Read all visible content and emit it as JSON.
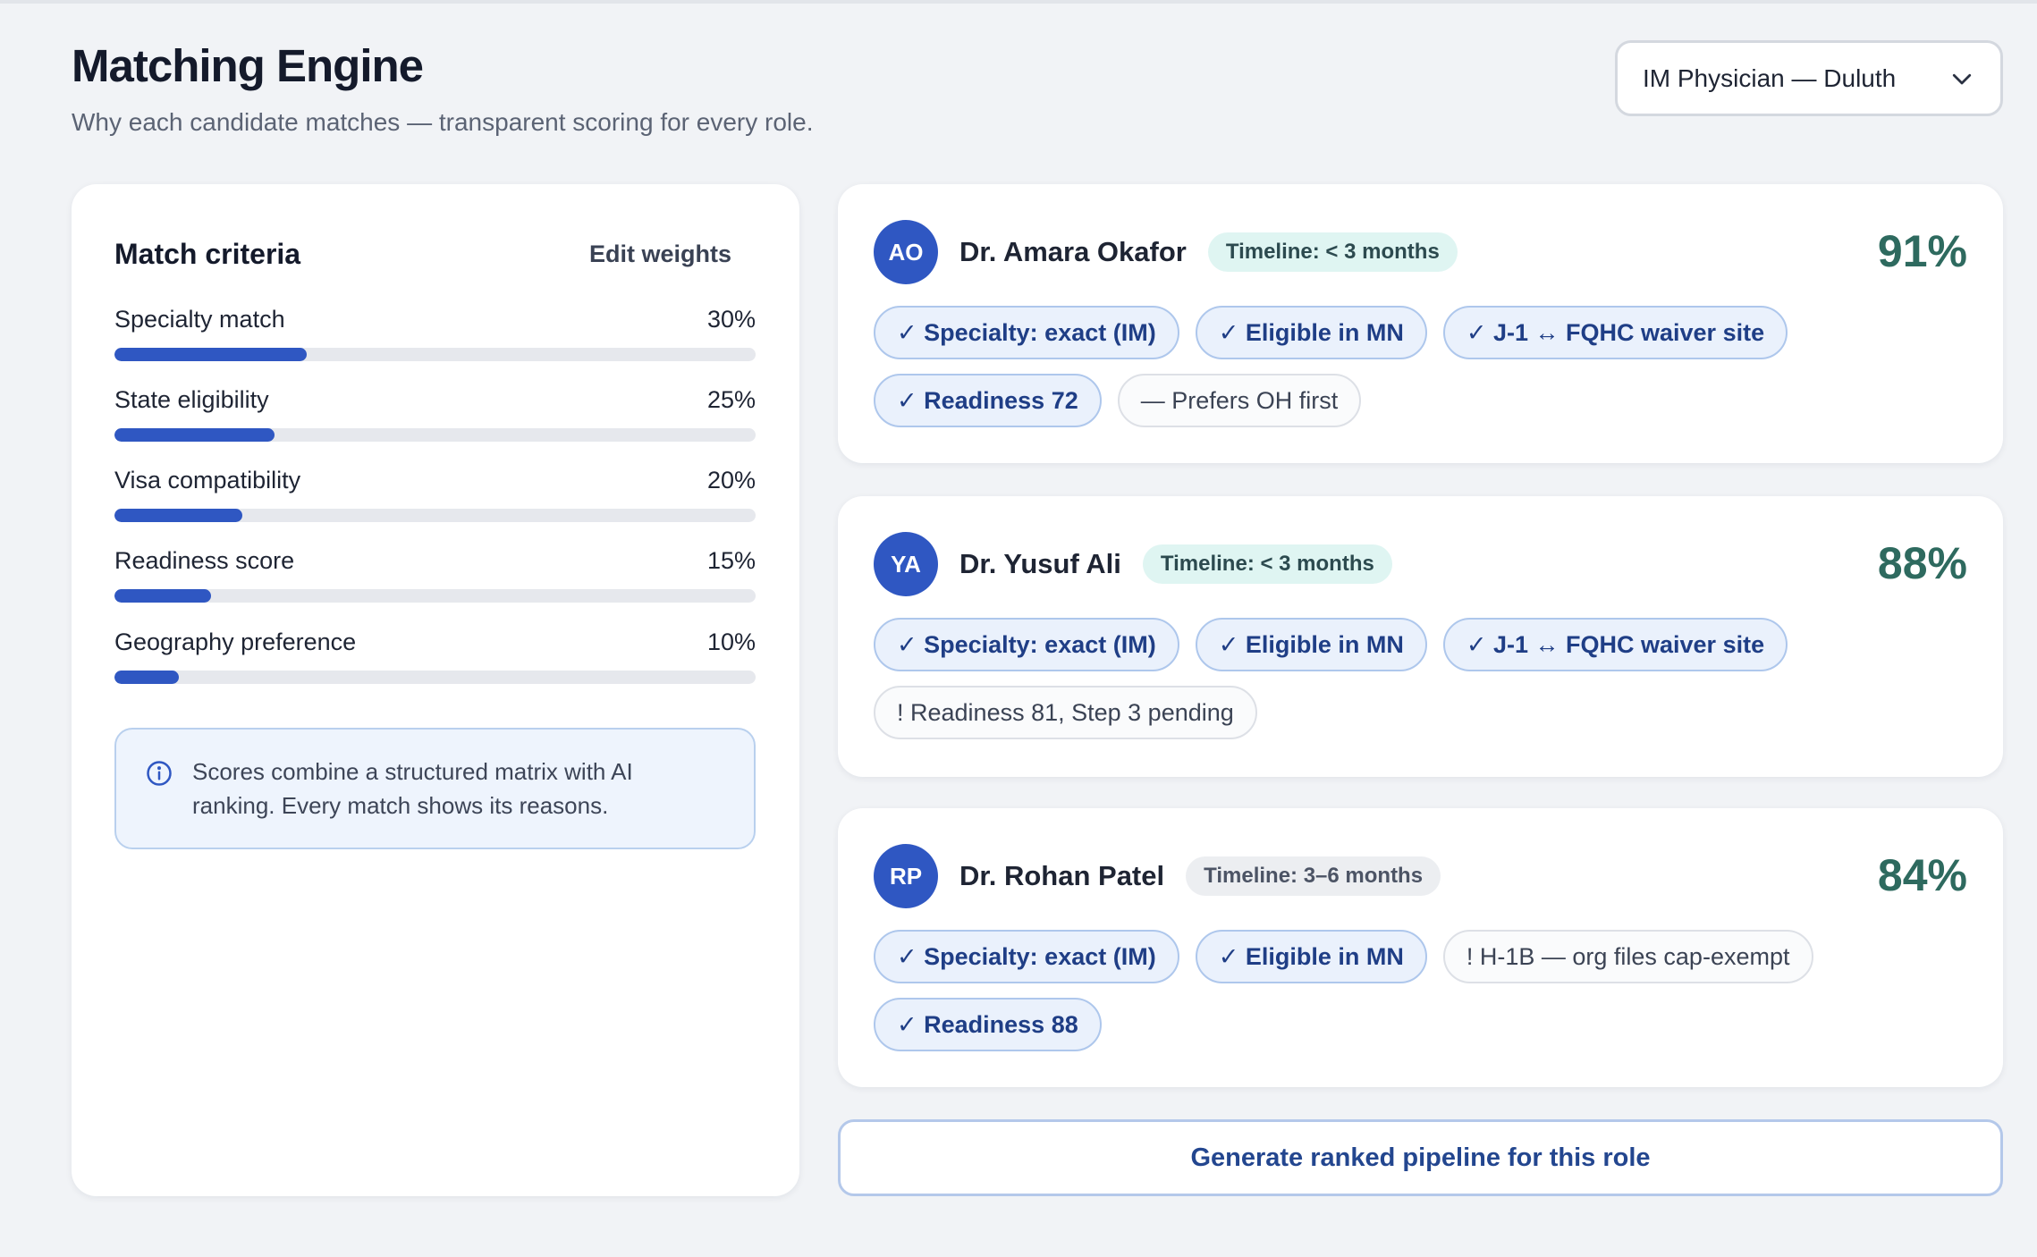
{
  "header": {
    "title": "Matching Engine",
    "subtitle": "Why each candidate matches — transparent scoring for every role."
  },
  "role_select": {
    "value": "IM Physician — Duluth",
    "icon": "chevron-down-icon"
  },
  "criteria": {
    "title": "Match criteria",
    "edit_label": "Edit weights",
    "items": [
      {
        "label": "Specialty match",
        "weight": "30%",
        "fraction": 0.3
      },
      {
        "label": "State eligibility",
        "weight": "25%",
        "fraction": 0.25
      },
      {
        "label": "Visa compatibility",
        "weight": "20%",
        "fraction": 0.2
      },
      {
        "label": "Readiness score",
        "weight": "15%",
        "fraction": 0.15
      },
      {
        "label": "Geography preference",
        "weight": "10%",
        "fraction": 0.1
      }
    ],
    "info_text": "Scores combine a structured matrix with AI ranking. Every match shows its reasons.",
    "info_icon": "info-icon"
  },
  "candidates": [
    {
      "initials": "AO",
      "name": "Dr. Amara Okafor",
      "timeline": "Timeline: < 3 months",
      "score": "91%",
      "chips": [
        "✓ Specialty: exact (IM)",
        "✓ Eligible in MN",
        "✓ J-1 ↔ FQHC waiver site",
        "✓ Readiness 72",
        "— Prefers OH first"
      ]
    },
    {
      "initials": "YA",
      "name": "Dr. Yusuf Ali",
      "timeline": "Timeline: < 3 months",
      "score": "88%",
      "chips": [
        "✓ Specialty: exact (IM)",
        "✓ Eligible in MN",
        "✓ J-1 ↔ FQHC waiver site",
        "! Readiness 81, Step 3 pending"
      ]
    },
    {
      "initials": "RP",
      "name": "Dr. Rohan Patel",
      "timeline": "Timeline: 3–6 months",
      "score": "84%",
      "chips": [
        "✓ Specialty: exact (IM)",
        "✓ Eligible in MN",
        "! H-1B — org files cap-exempt",
        "✓ Readiness 88"
      ]
    }
  ],
  "generate_label": "Generate ranked pipeline for this role",
  "colors": {
    "accent": "#2f57c2",
    "score": "#2e6a5f",
    "timeline_soon": "#dff5f2",
    "timeline_later": "#eceef1"
  }
}
